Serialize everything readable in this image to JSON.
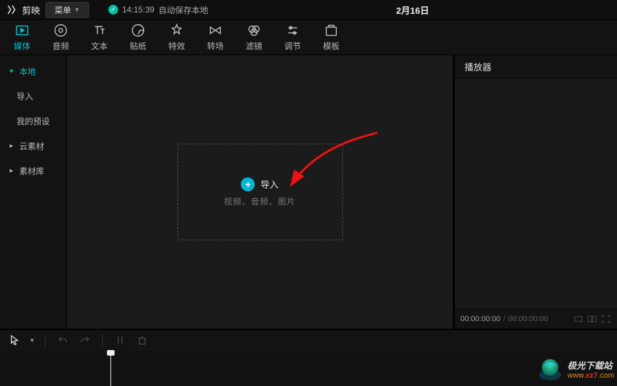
{
  "topbar": {
    "app_name": "剪映",
    "menu_label": "菜单",
    "save_time": "14:15:39",
    "save_text": "自动保存本地",
    "project_date": "2月16日"
  },
  "tooltabs": [
    {
      "id": "media",
      "label": "媒体",
      "active": true
    },
    {
      "id": "audio",
      "label": "音频"
    },
    {
      "id": "text",
      "label": "文本"
    },
    {
      "id": "sticker",
      "label": "贴纸"
    },
    {
      "id": "effect",
      "label": "特效"
    },
    {
      "id": "transition",
      "label": "转场"
    },
    {
      "id": "filter",
      "label": "滤镜"
    },
    {
      "id": "adjust",
      "label": "调节"
    },
    {
      "id": "template",
      "label": "模板"
    }
  ],
  "sidebar": {
    "items": [
      {
        "label": "本地",
        "caret": "▾",
        "active": true
      },
      {
        "label": "导入",
        "sub": true
      },
      {
        "label": "我的预设",
        "sub": true
      },
      {
        "label": "云素材",
        "caret": "▸"
      },
      {
        "label": "素材库",
        "caret": "▸"
      }
    ]
  },
  "import_box": {
    "label": "导入",
    "hint": "视频、音频、图片"
  },
  "player": {
    "title": "播放器",
    "current": "00:00:00:00",
    "total": "00:00:00:00"
  },
  "watermark": {
    "line1": "极光下载站",
    "line2_a": "www.",
    "line2_b": "xz7",
    "line2_c": ".com"
  }
}
